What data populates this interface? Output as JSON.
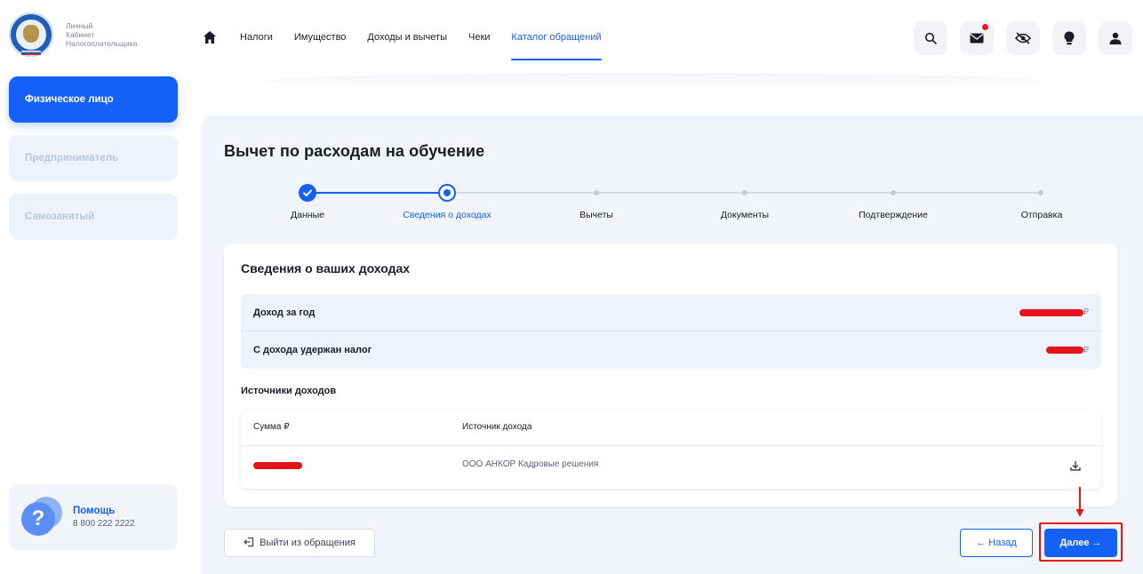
{
  "logo": {
    "line1": "Личный",
    "line2": "Кабинет",
    "line3": "Налогоплательщика"
  },
  "nav": {
    "home_icon": "home-icon",
    "items": [
      {
        "label": "Налоги"
      },
      {
        "label": "Имущество"
      },
      {
        "label": "Доходы и вычеты"
      },
      {
        "label": "Чеки"
      },
      {
        "label": "Каталог обращений",
        "active": true
      }
    ]
  },
  "top_icons": [
    "search-icon",
    "mail-icon",
    "eye-off-icon",
    "lightbulb-icon",
    "user-icon"
  ],
  "sidebar": {
    "items": [
      {
        "label": "Физическое лицо",
        "active": true
      },
      {
        "label": "Предприниматель"
      },
      {
        "label": "Самозанятый"
      }
    ],
    "help": {
      "title": "Помощь",
      "phone": "8 800 222 2222"
    }
  },
  "main": {
    "title": "Вычет по расходам на обучение",
    "steps": [
      {
        "label": "Данные",
        "state": "done"
      },
      {
        "label": "Сведения о доходах",
        "state": "current"
      },
      {
        "label": "Вычеты",
        "state": "todo"
      },
      {
        "label": "Документы",
        "state": "todo"
      },
      {
        "label": "Подтверждение",
        "state": "todo"
      },
      {
        "label": "Отправка",
        "state": "todo"
      }
    ],
    "card": {
      "title": "Сведения о ваших доходах",
      "rows": [
        {
          "label": "Доход за год",
          "currency": "₽"
        },
        {
          "label": "С дохода удержан налог",
          "currency": "₽"
        }
      ],
      "sources_title": "Источники доходов",
      "table": {
        "headers": [
          "Сумма ₽",
          "Источник дохода"
        ],
        "rows": [
          {
            "source": "ООО АНКОР Кадровые решения"
          }
        ]
      }
    },
    "buttons": {
      "exit": "Выйти из обращения",
      "back": "← Назад",
      "next": "Далее →"
    }
  },
  "colors": {
    "accent": "#1560f7",
    "annotation": "#e5141c",
    "panel": "#f1f4f9"
  }
}
